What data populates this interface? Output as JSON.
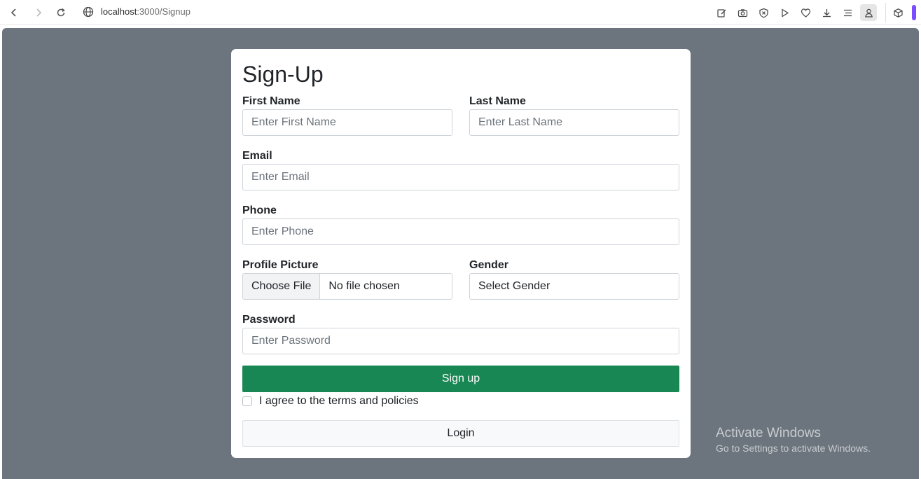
{
  "browser": {
    "url_host": "localhost",
    "url_path": ":3000/Signup",
    "accent_color": "#7c4dff"
  },
  "form": {
    "title": "Sign-Up",
    "first_name": {
      "label": "First Name",
      "placeholder": "Enter First Name"
    },
    "last_name": {
      "label": "Last Name",
      "placeholder": "Enter Last Name"
    },
    "email": {
      "label": "Email",
      "placeholder": "Enter Email"
    },
    "phone": {
      "label": "Phone",
      "placeholder": "Enter Phone"
    },
    "profile_picture": {
      "label": "Profile Picture",
      "button_label": "Choose File",
      "status": "No file chosen"
    },
    "gender": {
      "label": "Gender",
      "selected": "Select Gender"
    },
    "password": {
      "label": "Password",
      "placeholder": "Enter Password"
    },
    "signup_button": "Sign up",
    "terms_label": "I agree to the terms and policies",
    "login_button": "Login"
  },
  "watermark": {
    "title": "Activate Windows",
    "subtitle": "Go to Settings to activate Windows."
  },
  "colors": {
    "page_background": "#6c757d",
    "primary_button": "#198754"
  }
}
